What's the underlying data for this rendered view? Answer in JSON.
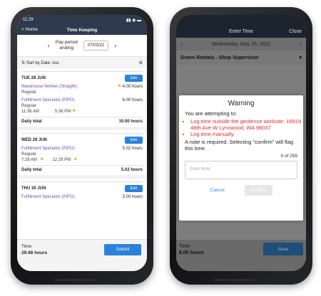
{
  "left": {
    "status": {
      "time": "11:29",
      "icons": "▮▮ ◉ ▬"
    },
    "nav": {
      "back": "< Home",
      "title": "Time Keeping"
    },
    "period": {
      "label_line1": "Pay period",
      "label_line2": "ending",
      "date": "07/03/22",
      "prev": "‹",
      "next": "›"
    },
    "sort": {
      "label": "Sort by Date: Asc",
      "gear": "⚙",
      "arrow": "⇅"
    },
    "days": [
      {
        "date": "TUE 28 JUN",
        "edit": "Edit",
        "entries": [
          {
            "job": "Warehouse Worker (Straight)",
            "hours": "4.00 hours",
            "type": "Regular",
            "flag": "⚑"
          },
          {
            "job": "Fulfillment Specialist (PIPO)",
            "hours": "6.00 hours",
            "type": "Regular",
            "in": "11:36 AM",
            "out": "5:36 PM",
            "flag": "⚑"
          }
        ],
        "total_label": "Daily total",
        "total": "10.00 hours"
      },
      {
        "date": "WED 29 JUN",
        "edit": "Edit",
        "entries": [
          {
            "job": "Fulfillment Specialist (PIPO)",
            "hours": "5.02 hours",
            "type": "Regular",
            "in": "7:28 AM",
            "out": "12:29 PM",
            "flag": "⚑"
          }
        ],
        "total_label": "Daily total",
        "total": "5.02 hours"
      },
      {
        "date": "THU 30 JUN",
        "edit": "Edit",
        "entries": [
          {
            "job": "Fulfillment Specialist (PIPO)",
            "hours": "3.00 hours"
          }
        ]
      }
    ],
    "footer": {
      "label": "Time",
      "value": "29.48 hours",
      "submit": "Submit"
    }
  },
  "right": {
    "nav": {
      "title": "Enter Time",
      "close": "Close"
    },
    "date": {
      "prev": "‹",
      "value": "Wednesday, May 25, 2022",
      "next": "›"
    },
    "job": {
      "value": "Green Rentals - Shop Supervisor",
      "arrow": "▾"
    },
    "modal": {
      "title": "Warning",
      "intro": "You are attempting to:",
      "bullets": [
        "Log time outside the geofence worksite: 16919 48th Ave W Lynnwood, WA 98037",
        "Log time manually"
      ],
      "requirement": "A note is required. Selecting \"confirm\" will flag this time.",
      "counter": "0 of 255",
      "note_placeholder": "Enter Note",
      "cancel": "Cancel",
      "confirm": "Confirm"
    },
    "footer": {
      "label": "Time",
      "value": "8.00 hours",
      "save": "Save"
    }
  }
}
